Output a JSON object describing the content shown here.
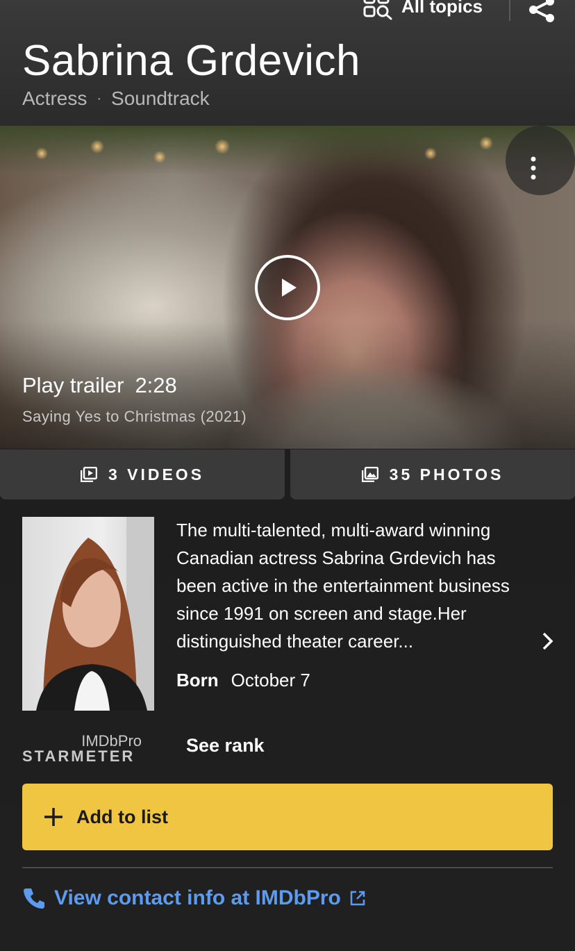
{
  "header": {
    "all_topics_label": "All topics",
    "name": "Sabrina Grdevich",
    "roles": [
      "Actress",
      "Soundtrack"
    ],
    "separator": "·"
  },
  "hero": {
    "play_label": "Play trailer",
    "duration": "2:28",
    "video_title": "Saying Yes to Christmas (2021)"
  },
  "media": {
    "videos_label": "3 VIDEOS",
    "photos_label": "35 PHOTOS"
  },
  "bio": {
    "text": "The multi-talented, multi-award winning Canadian actress Sabrina Grdevich has been active in the entertainment business since 1991 on screen and stage.Her distinguished theater career...",
    "born_label": "Born",
    "born_value": "October 7"
  },
  "starmeter": {
    "imdbpro_label": "IMDbPro",
    "label": "STARMETER",
    "see_rank": "See rank"
  },
  "actions": {
    "add_to_list": "Add to list",
    "contact_info": "View contact info at IMDbPro"
  },
  "colors": {
    "accent_yellow": "#f0c542",
    "link_blue": "#5c9bf0",
    "background": "#1f1f1f"
  },
  "icons": {
    "all_topics": "grid-search-icon",
    "share": "share-icon",
    "more": "more-vertical-icon",
    "play": "play-icon",
    "videos": "video-library-icon",
    "photos": "photo-library-icon",
    "chevron": "chevron-right-icon",
    "add": "plus-icon",
    "phone": "phone-icon",
    "external": "external-link-icon"
  }
}
